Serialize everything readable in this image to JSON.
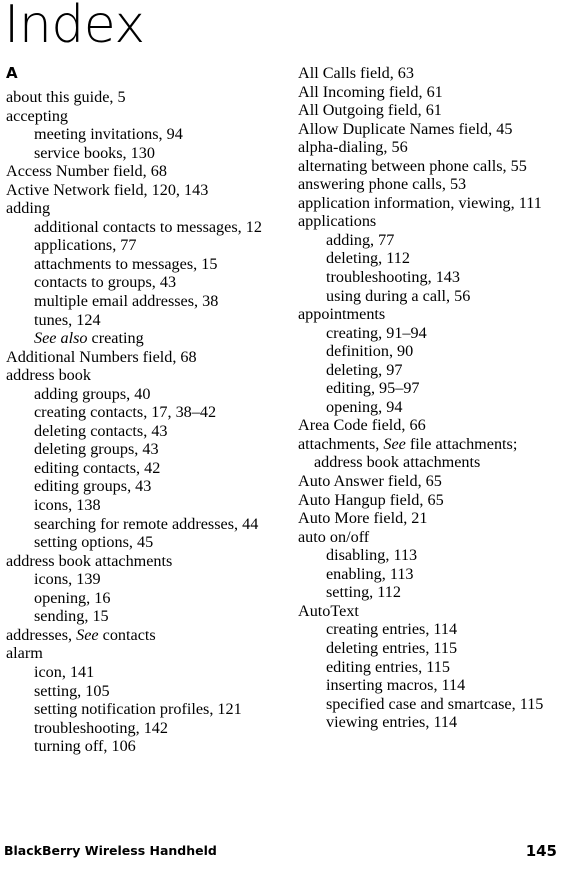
{
  "document": {
    "title": "Index",
    "section_letter": "A"
  },
  "columns": {
    "left": [
      {
        "level": 1,
        "text": "about this guide, 5"
      },
      {
        "level": 1,
        "text": "accepting"
      },
      {
        "level": 2,
        "text": "meeting invitations, 94"
      },
      {
        "level": 2,
        "text": "service books, 130"
      },
      {
        "level": 1,
        "text": "Access Number field, 68"
      },
      {
        "level": 1,
        "text": "Active Network field, 120, 143"
      },
      {
        "level": 1,
        "text": "adding"
      },
      {
        "level": 2,
        "text": "additional contacts to messages, 12"
      },
      {
        "level": 2,
        "text": "applications, 77"
      },
      {
        "level": 2,
        "text": "attachments to messages, 15"
      },
      {
        "level": 2,
        "text": "contacts to groups, 43"
      },
      {
        "level": 2,
        "text": "multiple email addresses, 38"
      },
      {
        "level": 2,
        "text": "tunes, 124"
      },
      {
        "level": 2,
        "text": "See also creating",
        "italic_prefix": "See also",
        "italic_rest": " creating"
      },
      {
        "level": 1,
        "text": "Additional Numbers field, 68"
      },
      {
        "level": 1,
        "text": "address book"
      },
      {
        "level": 2,
        "text": "adding groups, 40"
      },
      {
        "level": 2,
        "text": "creating contacts, 17, 38–42"
      },
      {
        "level": 2,
        "text": "deleting contacts, 43"
      },
      {
        "level": 2,
        "text": "deleting groups, 43"
      },
      {
        "level": 2,
        "text": "editing contacts, 42"
      },
      {
        "level": 2,
        "text": "editing groups, 43"
      },
      {
        "level": 2,
        "text": "icons, 138"
      },
      {
        "level": 2,
        "text": "searching for remote addresses, 44"
      },
      {
        "level": 2,
        "text": "setting options, 45"
      },
      {
        "level": 1,
        "text": "address book attachments"
      },
      {
        "level": 2,
        "text": "icons, 139"
      },
      {
        "level": 2,
        "text": "opening, 16"
      },
      {
        "level": 2,
        "text": "sending, 15"
      },
      {
        "level": 1,
        "text": "addresses, See contacts",
        "plain_prefix": "addresses, ",
        "italic_prefix": "See",
        "italic_rest": " contacts"
      },
      {
        "level": 1,
        "text": "alarm"
      },
      {
        "level": 2,
        "text": "icon, 141"
      },
      {
        "level": 2,
        "text": "setting, 105"
      },
      {
        "level": 2,
        "text": "setting notification profiles, 121"
      },
      {
        "level": 2,
        "text": "troubleshooting, 142"
      },
      {
        "level": 2,
        "text": "turning off, 106"
      }
    ],
    "right": [
      {
        "level": 1,
        "text": "All Calls field, 63"
      },
      {
        "level": 1,
        "text": "All Incoming field, 61"
      },
      {
        "level": 1,
        "text": "All Outgoing field, 61"
      },
      {
        "level": 1,
        "text": "Allow Duplicate Names field, 45"
      },
      {
        "level": 1,
        "text": "alpha-dialing, 56"
      },
      {
        "level": 1,
        "text": "alternating between phone calls, 55"
      },
      {
        "level": 1,
        "text": "answering phone calls, 53"
      },
      {
        "level": 1,
        "text": "application information, viewing, 111"
      },
      {
        "level": 1,
        "text": "applications"
      },
      {
        "level": 2,
        "text": "adding, 77"
      },
      {
        "level": 2,
        "text": "deleting, 112"
      },
      {
        "level": 2,
        "text": "troubleshooting, 143"
      },
      {
        "level": 2,
        "text": "using during a call, 56"
      },
      {
        "level": 1,
        "text": "appointments"
      },
      {
        "level": 2,
        "text": "creating, 91–94"
      },
      {
        "level": 2,
        "text": "definition, 90"
      },
      {
        "level": 2,
        "text": "deleting, 97"
      },
      {
        "level": 2,
        "text": "editing, 95–97"
      },
      {
        "level": 2,
        "text": "opening, 94"
      },
      {
        "level": 1,
        "text": "Area Code field, 66"
      },
      {
        "level": 1,
        "text": "attachments, See file attachments; address book attachments",
        "plain_prefix": "attachments, ",
        "italic_prefix": "See",
        "italic_rest": " file attachments; address book attachments"
      },
      {
        "level": 1,
        "text": "Auto Answer field, 65"
      },
      {
        "level": 1,
        "text": "Auto Hangup field, 65"
      },
      {
        "level": 1,
        "text": "Auto More field, 21"
      },
      {
        "level": 1,
        "text": "auto on/off"
      },
      {
        "level": 2,
        "text": "disabling, 113"
      },
      {
        "level": 2,
        "text": "enabling, 113"
      },
      {
        "level": 2,
        "text": "setting, 112"
      },
      {
        "level": 1,
        "text": "AutoText"
      },
      {
        "level": 2,
        "text": "creating entries, 114"
      },
      {
        "level": 2,
        "text": "deleting entries, 115"
      },
      {
        "level": 2,
        "text": "editing entries, 115"
      },
      {
        "level": 2,
        "text": "inserting macros, 114"
      },
      {
        "level": 2,
        "text": "specified case and smartcase, 115"
      },
      {
        "level": 2,
        "text": "viewing entries, 114"
      }
    ]
  },
  "footer": {
    "product": "BlackBerry Wireless Handheld",
    "page_number": "145"
  }
}
